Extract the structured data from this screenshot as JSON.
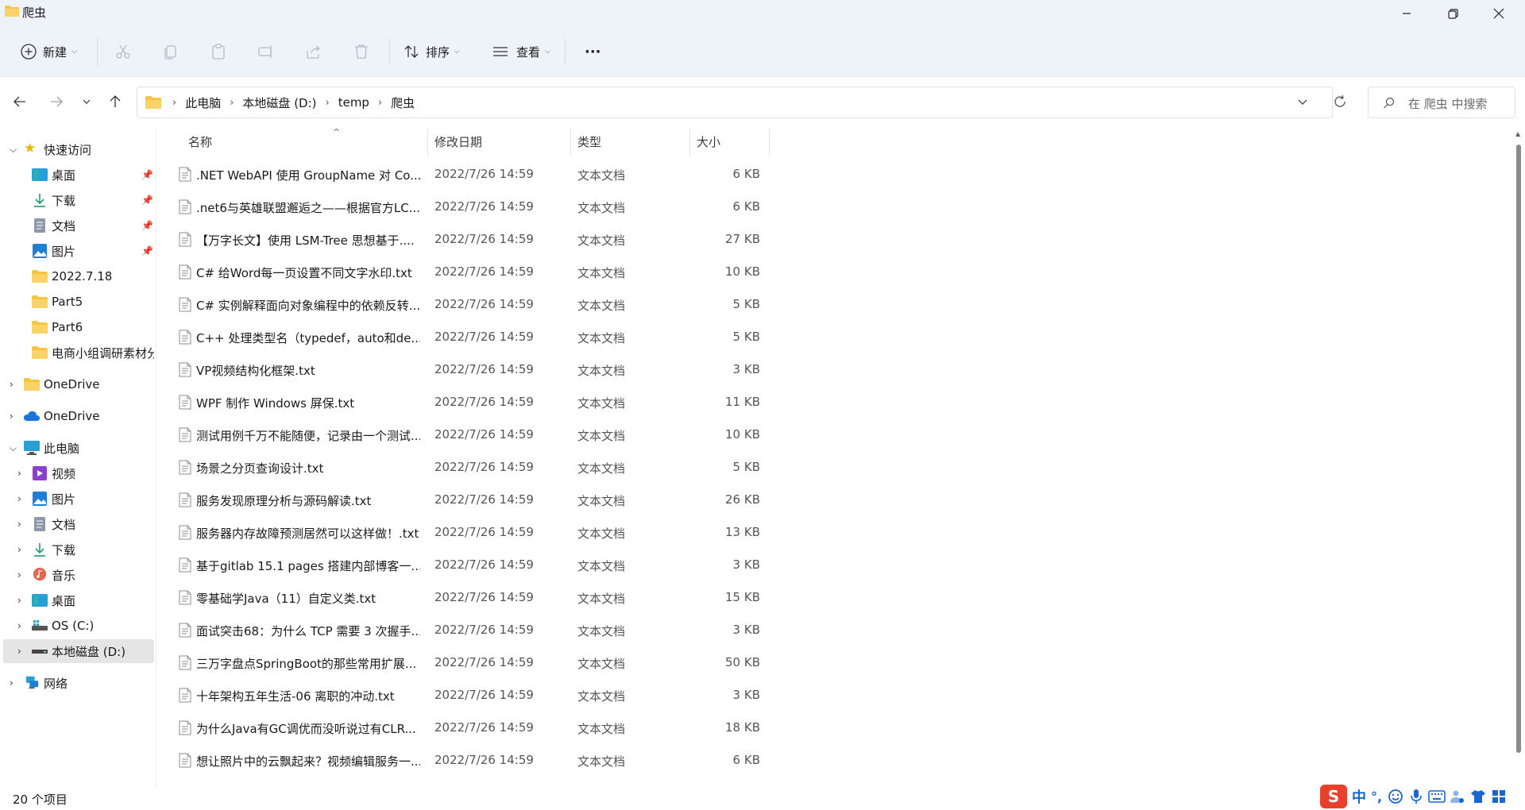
{
  "window": {
    "title": "爬虫"
  },
  "toolbar": {
    "new_label": "新建",
    "sort_label": "排序",
    "view_label": "查看",
    "more_label": "···"
  },
  "address": {
    "crumbs": [
      "此电脑",
      "本地磁盘 (D:)",
      "temp",
      "爬虫"
    ]
  },
  "search": {
    "placeholder": "在 爬虫 中搜索"
  },
  "nav": {
    "quick_access": "快速访问",
    "quick_items": [
      {
        "label": "桌面",
        "icon": "desktop-icon",
        "pinned": true
      },
      {
        "label": "下载",
        "icon": "download-icon",
        "pinned": true
      },
      {
        "label": "文档",
        "icon": "document-icon",
        "pinned": true
      },
      {
        "label": "图片",
        "icon": "picture-icon",
        "pinned": true
      },
      {
        "label": "2022.7.18",
        "icon": "folder-icon",
        "pinned": false
      },
      {
        "label": "Part5",
        "icon": "folder-icon",
        "pinned": false
      },
      {
        "label": "Part6",
        "icon": "folder-icon",
        "pinned": false
      },
      {
        "label": "电商小组调研素材分",
        "icon": "folder-icon",
        "pinned": false
      }
    ],
    "onedrive_personal": "OneDrive",
    "onedrive": "OneDrive",
    "this_pc": "此电脑",
    "pc_items": [
      {
        "label": "视频",
        "icon": "video-icon"
      },
      {
        "label": "图片",
        "icon": "picture-icon"
      },
      {
        "label": "文档",
        "icon": "document-icon"
      },
      {
        "label": "下载",
        "icon": "download-icon"
      },
      {
        "label": "音乐",
        "icon": "music-icon"
      },
      {
        "label": "桌面",
        "icon": "desktop-icon"
      },
      {
        "label": "OS (C:)",
        "icon": "drive-c-icon"
      },
      {
        "label": "本地磁盘 (D:)",
        "icon": "drive-d-icon"
      }
    ],
    "network": "网络"
  },
  "columns": {
    "name": "名称",
    "date": "修改日期",
    "type": "类型",
    "size": "大小"
  },
  "files": [
    {
      "name": ".NET WebAPI 使用 GroupName 对 Co...",
      "date": "2022/7/26 14:59",
      "type": "文本文档",
      "size": "6 KB"
    },
    {
      "name": ".net6与英雄联盟邂逅之——根据官方LC...",
      "date": "2022/7/26 14:59",
      "type": "文本文档",
      "size": "6 KB"
    },
    {
      "name": "【万字长文】使用 LSM-Tree 思想基于....",
      "date": "2022/7/26 14:59",
      "type": "文本文档",
      "size": "27 KB"
    },
    {
      "name": "C# 给Word每一页设置不同文字水印.txt",
      "date": "2022/7/26 14:59",
      "type": "文本文档",
      "size": "10 KB"
    },
    {
      "name": "C# 实例解释面向对象编程中的依赖反转...",
      "date": "2022/7/26 14:59",
      "type": "文本文档",
      "size": "5 KB"
    },
    {
      "name": "C++ 处理类型名（typedef，auto和de...",
      "date": "2022/7/26 14:59",
      "type": "文本文档",
      "size": "5 KB"
    },
    {
      "name": "VP视频结构化框架.txt",
      "date": "2022/7/26 14:59",
      "type": "文本文档",
      "size": "3 KB"
    },
    {
      "name": "WPF 制作 Windows 屏保.txt",
      "date": "2022/7/26 14:59",
      "type": "文本文档",
      "size": "11 KB"
    },
    {
      "name": "测试用例千万不能随便，记录由一个测试...",
      "date": "2022/7/26 14:59",
      "type": "文本文档",
      "size": "10 KB"
    },
    {
      "name": "场景之分页查询设计.txt",
      "date": "2022/7/26 14:59",
      "type": "文本文档",
      "size": "5 KB"
    },
    {
      "name": "服务发现原理分析与源码解读.txt",
      "date": "2022/7/26 14:59",
      "type": "文本文档",
      "size": "26 KB"
    },
    {
      "name": "服务器内存故障预测居然可以这样做！.txt",
      "date": "2022/7/26 14:59",
      "type": "文本文档",
      "size": "13 KB"
    },
    {
      "name": "基于gitlab 15.1 pages 搭建内部博客一...",
      "date": "2022/7/26 14:59",
      "type": "文本文档",
      "size": "3 KB"
    },
    {
      "name": "零基础学Java（11）自定义类.txt",
      "date": "2022/7/26 14:59",
      "type": "文本文档",
      "size": "15 KB"
    },
    {
      "name": "面试突击68：为什么 TCP 需要 3 次握手...",
      "date": "2022/7/26 14:59",
      "type": "文本文档",
      "size": "3 KB"
    },
    {
      "name": "三万字盘点SpringBoot的那些常用扩展...",
      "date": "2022/7/26 14:59",
      "type": "文本文档",
      "size": "50 KB"
    },
    {
      "name": "十年架构五年生活-06 离职的冲动.txt",
      "date": "2022/7/26 14:59",
      "type": "文本文档",
      "size": "3 KB"
    },
    {
      "name": "为什么Java有GC调优而没听说过有CLR...",
      "date": "2022/7/26 14:59",
      "type": "文本文档",
      "size": "18 KB"
    },
    {
      "name": "想让照片中的云飘起来？视频编辑服务一...",
      "date": "2022/7/26 14:59",
      "type": "文本文档",
      "size": "6 KB"
    }
  ],
  "status": {
    "item_count": "20 个项目"
  },
  "ime": {
    "logo": "S",
    "mode": "中",
    "punct": "°,"
  },
  "colors": {
    "chrome_bg": "#eef3fa",
    "selected_bg": "#e5e5e5",
    "folder_yellow": "#f5c542",
    "accent_blue": "#1a66d1",
    "ime_red": "#e8412b"
  }
}
